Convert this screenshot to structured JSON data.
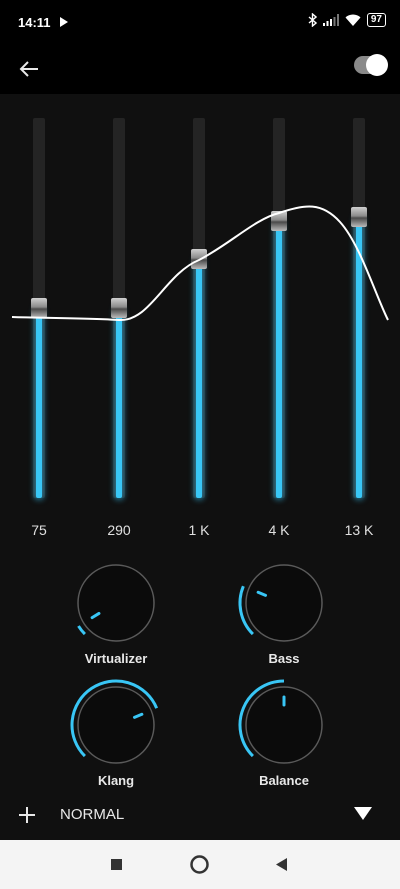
{
  "status": {
    "time": "14:11",
    "battery": "97",
    "icons": [
      "play-icon",
      "bluetooth-icon",
      "signal-icon",
      "wifi-icon",
      "battery-icon"
    ]
  },
  "appbar": {
    "back_icon": "arrow-left-icon",
    "toggle_on": true
  },
  "equalizer": {
    "level_scale": "0 = bottom of slider, 1 = top of slider",
    "bands": [
      {
        "label": "75",
        "level": 0.5
      },
      {
        "label": "290",
        "level": 0.5
      },
      {
        "label": "1 K",
        "level": 0.63
      },
      {
        "label": "4 K",
        "level": 0.73
      },
      {
        "label": "13 K",
        "level": 0.74
      }
    ],
    "fill_color": "#39c6f5",
    "curve_color": "#ffffff"
  },
  "effects": {
    "virtualizer": {
      "label": "Virtualizer",
      "level": 0.05
    },
    "bass": {
      "label": "Bass",
      "level": 0.25
    },
    "klang": {
      "label": "Klang",
      "level": 0.75
    },
    "balance": {
      "label": "Balance",
      "level": 0.5
    }
  },
  "bottom": {
    "add_icon": "plus-icon",
    "preset": "NORMAL",
    "dropdown_icon": "triangle-down-icon"
  },
  "navbar": {
    "icons": [
      "recents-square-icon",
      "home-circle-icon",
      "back-triangle-icon"
    ]
  }
}
